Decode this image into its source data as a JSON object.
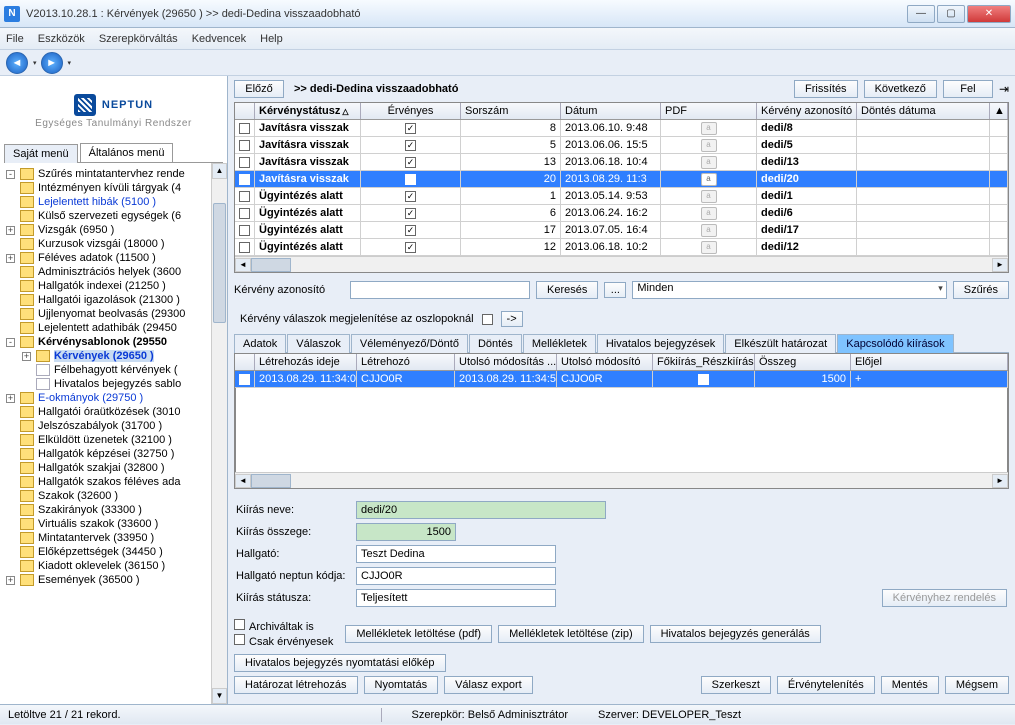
{
  "window": {
    "title": "V2013.10.28.1 : Kérvények (29650  )  >> dedi-Dedina visszaadobható"
  },
  "menu": [
    "File",
    "Eszközök",
    "Szerepkörváltás",
    "Kedvencek",
    "Help"
  ],
  "logo": {
    "brand": "NEPTUN",
    "sub": "Egységes Tanulmányi Rendszer"
  },
  "leftTabs": {
    "own": "Saját menü",
    "gen": "Általános menü"
  },
  "tree": [
    {
      "label": "Szűrés mintatantervhez rende",
      "exp": "-"
    },
    {
      "label": "Intézményen kívüli tárgyak (4"
    },
    {
      "label": "Lejelentett hibák (5100  )",
      "link": true
    },
    {
      "label": "Külső szervezeti egységek (6"
    },
    {
      "label": "Vizsgák (6950  )",
      "exp": "+"
    },
    {
      "label": "Kurzusok vizsgái (18000  )"
    },
    {
      "label": "Féléves adatok (11500  )",
      "exp": "+"
    },
    {
      "label": "Adminisztrációs helyek (3600"
    },
    {
      "label": "Hallgatók indexei (21250  )"
    },
    {
      "label": "Hallgatói igazolások (21300  )"
    },
    {
      "label": "Ujjlenyomat beolvasás (29300"
    },
    {
      "label": "Lejelentett adathibák (29450"
    },
    {
      "label": "Kérvénysablonok (29550",
      "bold": true,
      "exp": "-"
    },
    {
      "label": "Kérvények (29650  )",
      "bold": true,
      "link": true,
      "sel": true,
      "level": 2,
      "exp": "+"
    },
    {
      "label": "Félbehagyott kérvények (",
      "level": 2,
      "icon": "pg"
    },
    {
      "label": "Hivatalos bejegyzés sablo",
      "level": 2,
      "icon": "pg"
    },
    {
      "label": "E-okmányok (29750  )",
      "link": true,
      "exp": "+"
    },
    {
      "label": "Hallgatói óraütközések (3010"
    },
    {
      "label": "Jelszószabályok (31700  )"
    },
    {
      "label": "Elküldött üzenetek (32100  )"
    },
    {
      "label": "Hallgatók képzései (32750  )"
    },
    {
      "label": "Hallgatók szakjai (32800  )"
    },
    {
      "label": "Hallgatók szakos féléves ada"
    },
    {
      "label": "Szakok (32600  )"
    },
    {
      "label": "Szakirányok (33300  )"
    },
    {
      "label": "Virtuális szakok (33600  )"
    },
    {
      "label": "Mintatantervek (33950  )"
    },
    {
      "label": "Előképzettségek (34450  )"
    },
    {
      "label": "Kiadott oklevelek (36150  )"
    },
    {
      "label": "Események (36500  )",
      "exp": "+"
    }
  ],
  "rtop": {
    "prev": "Előző",
    "title": ">> dedi-Dedina visszaadobható",
    "refresh": "Frissítés",
    "next": "Következő",
    "up": "Fel"
  },
  "gridCols": [
    "",
    "Kérvénystátusz",
    "Érvényes",
    "Sorszám",
    "Dátum",
    "PDF",
    "Kérvény azonosító",
    "Döntés dátuma"
  ],
  "gridRows": [
    {
      "status": "Javításra visszak",
      "valid": true,
      "seq": "8",
      "date": "2013.06.10. 9:48",
      "id": "dedi/8"
    },
    {
      "status": "Javításra visszak",
      "valid": true,
      "seq": "5",
      "date": "2013.06.06. 15:5",
      "id": "dedi/5"
    },
    {
      "status": "Javításra visszak",
      "valid": true,
      "seq": "13",
      "date": "2013.06.18. 10:4",
      "id": "dedi/13"
    },
    {
      "status": "Javításra visszak",
      "valid": true,
      "seq": "20",
      "date": "2013.08.29. 11:3",
      "id": "dedi/20",
      "sel": true
    },
    {
      "status": "Ügyintézés alatt",
      "valid": true,
      "seq": "1",
      "date": "2013.05.14. 9:53",
      "id": "dedi/1"
    },
    {
      "status": "Ügyintézés alatt",
      "valid": true,
      "seq": "6",
      "date": "2013.06.24. 16:2",
      "id": "dedi/6"
    },
    {
      "status": "Ügyintézés alatt",
      "valid": true,
      "seq": "17",
      "date": "2013.07.05. 16:4",
      "id": "dedi/17"
    },
    {
      "status": "Ügyintézés alatt",
      "valid": true,
      "seq": "12",
      "date": "2013.06.18. 10:2",
      "id": "dedi/12"
    }
  ],
  "search": {
    "label": "Kérvény azonosító",
    "btn": "Keresés",
    "dots": "...",
    "all": "Minden",
    "filter": "Szűrés"
  },
  "mid": {
    "label": "Kérvény válaszok megjelenítése az oszlopoknál",
    "go": "->"
  },
  "tabs2": [
    "Adatok",
    "Válaszok",
    "Véleményező/Döntő",
    "Döntés",
    "Mellékletek",
    "Hivatalos bejegyzések",
    "Elkészült határozat",
    "Kapcsolódó kiírások"
  ],
  "grid2Cols": [
    "",
    "Létrehozás ideje",
    "Létrehozó",
    "Utolsó módosítás ...",
    "Utolsó módosító",
    "Főkiírás_Részkiírás",
    "Összeg",
    "Előjel"
  ],
  "grid2Row": {
    "created": "2013.08.29. 11:34:0",
    "creator": "CJJO0R",
    "modts": "2013.08.29. 11:34:5",
    "modby": "CJJO0R",
    "main": true,
    "amount": "1500",
    "sign": "+"
  },
  "form": {
    "l1": "Kiírás neve:",
    "v1": "dedi/20",
    "l2": "Kiírás összege:",
    "v2": "1500",
    "l3": "Hallgató:",
    "v3": "Teszt Dedina",
    "l4": "Hallgató neptun kódja:",
    "v4": "CJJO0R",
    "l5": "Kiírás státusza:",
    "v5": "Teljesített",
    "assign": "Kérvényhez rendelés"
  },
  "checks": {
    "arch": "Archiváltak is",
    "valid": "Csak érvényesek"
  },
  "btns": {
    "attpdf": "Mellékletek letöltése (pdf)",
    "attzip": "Mellékletek letöltése (zip)",
    "gen": "Hivatalos bejegyzés generálás",
    "preview": "Hivatalos bejegyzés nyomtatási előkép",
    "decree": "Határozat létrehozás",
    "print": "Nyomtatás",
    "export": "Válasz export",
    "edit": "Szerkeszt",
    "inval": "Érvénytelenítés",
    "save": "Mentés",
    "cancel": "Mégsem"
  },
  "status": {
    "records": "Letöltve 21 / 21 rekord.",
    "role": "Szerepkör: Belső Adminisztrátor",
    "server": "Szerver: DEVELOPER_Teszt"
  }
}
